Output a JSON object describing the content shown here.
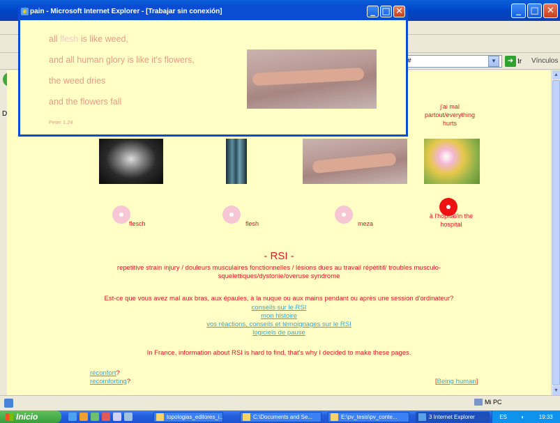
{
  "popup": {
    "title": "pain - Microsoft Internet Explorer - [Trabajar sin conexión]",
    "poem": {
      "line1_pre": "all ",
      "line1_flesh": "flesh",
      "line1_post": " is like weed,",
      "line2": "and all human glory is like it's flowers,",
      "line3": "the weed dries",
      "line4": "and the flowers fall",
      "source": "Peter 1.24"
    }
  },
  "browser": {
    "links_label": "Vínculos",
    "go_label": "Ir",
    "address_tail": "#",
    "menu_stub": "A",
    "address_stub": "Dir"
  },
  "page": {
    "side_note": "j'ai mal partout/everything hurts",
    "cd_labels": [
      "flesch",
      "flesh",
      "meza",
      "à l'hopital/in the hospital"
    ],
    "rsi_heading": "- RSI -",
    "rsi_definition": "repetitive strain injury / douleurs musculaires fonctionnelles / lésions dues au travail répétitif/ troubles musculo-squelettiques/dystonie/overuse syndrome",
    "question": "Est-ce que vous avez mal aux bras, aux épaules, à la nuque ou aux mains pendant ou après une session d'ordinateur?",
    "links": [
      "conseils sur le RSI",
      "mon histoire",
      "vos réactions, conseils et témoignages sur le RSI",
      "logiciels de pause"
    ],
    "france_note": "In France, information about RSI is hard to find, that's why I decided to make these pages.",
    "reconfort_link": "réconfort",
    "reconforting_link": "recomforting",
    "question_mark": "?",
    "being_human_link": "Being human",
    "bracket_open": "[",
    "bracket_close": "]"
  },
  "statusbar": {
    "zone": "Mi PC"
  },
  "taskbar": {
    "start": "Inicio",
    "tasks": [
      "topologias_editores_i...",
      "C:\\Documents and Se...",
      "E:\\pv_tesis\\pv_conte...",
      "3 Internet Explorer"
    ],
    "tray_lang": "ES",
    "clock": "19:33"
  },
  "colors": {
    "page_bg": "#ffffc6",
    "red_text": "#e8141e",
    "link": "#3aa6cf",
    "poem": "#ea9a86",
    "xp_blue": "#0a4dd3"
  }
}
